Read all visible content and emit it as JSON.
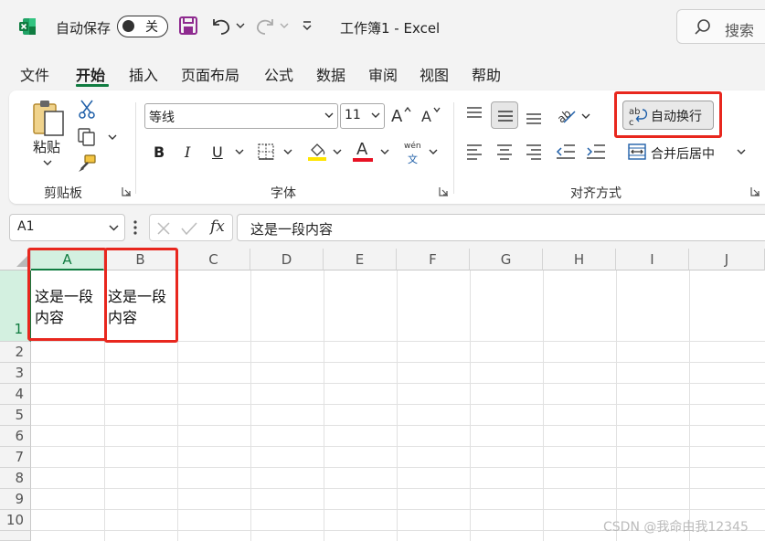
{
  "titlebar": {
    "autosave_label": "自动保存",
    "toggle_state": "关",
    "doc_title": "工作簿1  -  Excel",
    "search_placeholder": "搜索"
  },
  "tabs": [
    "文件",
    "开始",
    "插入",
    "页面布局",
    "公式",
    "数据",
    "审阅",
    "视图",
    "帮助"
  ],
  "active_tab": "开始",
  "ribbon": {
    "clipboard": {
      "paste_label": "粘贴",
      "group_label": "剪贴板"
    },
    "font": {
      "font_name": "等线",
      "font_size": "11",
      "bold": "B",
      "italic": "I",
      "underline": "U",
      "font_color_glyph": "A",
      "phonetic_top": "wén",
      "phonetic_bottom": "文",
      "group_label": "字体"
    },
    "alignment": {
      "wrap_text_label": "自动换行",
      "merge_label": "合并后居中",
      "group_label": "对齐方式"
    },
    "colors": {
      "accent": "#107c41",
      "highlight_red": "#e8271e",
      "fill_yellow": "#ffe500",
      "font_red": "#e81123"
    }
  },
  "formula_bar": {
    "name_box": "A1",
    "fx": "fx",
    "content": "这是一段内容"
  },
  "grid": {
    "columns": [
      "A",
      "B",
      "C",
      "D",
      "E",
      "F",
      "G",
      "H",
      "I",
      "J"
    ],
    "rows": [
      "1",
      "2",
      "3",
      "4",
      "5",
      "6",
      "7",
      "8",
      "9",
      "10"
    ],
    "cells": {
      "A1": {
        "line1": "这是一段",
        "line2": "内容"
      },
      "B1": {
        "line1": "这是一段",
        "line2": "内容"
      }
    }
  },
  "watermark": "CSDN @我命由我12345"
}
